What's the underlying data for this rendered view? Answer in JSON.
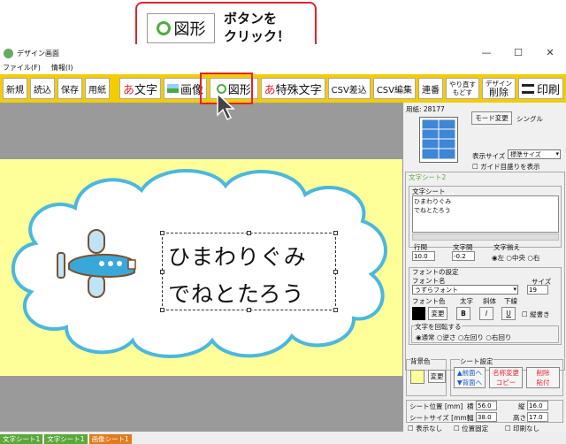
{
  "callout": {
    "button_label": "図形",
    "line1": "ボタンを",
    "line2": "クリック！"
  },
  "window": {
    "title": "デザイン画面",
    "minimize": "—",
    "maximize": "☐",
    "close": "✕"
  },
  "menu": [
    "ファイル(F)",
    "情報(I)"
  ],
  "toolbar": {
    "new": "新規",
    "open": "読込",
    "save": "保存",
    "paper": "用紙",
    "text_icon": "あ",
    "text": "文字",
    "image": "画像",
    "shape": "図形",
    "special_icon": "あ",
    "special": "特殊文字",
    "csv_insert": "CSV差込",
    "csv_edit": "CSV編集",
    "serial": "連番",
    "redo": "やり直す",
    "undo": "もどす",
    "design": "デザイン",
    "delete": "削除",
    "print": "印刷"
  },
  "canvas": {
    "line1": "ひまわりぐみ",
    "line2": "でねとたろう"
  },
  "panel": {
    "paper_label": "用紙: 28177",
    "mode_button": "モード変更",
    "mode_value": "シングル",
    "display_size_label": "表示サイズ",
    "display_size_value": "標準サイズ",
    "guide_label": "ガイド目盛りを表示",
    "sheet_title": "文字シート2",
    "text_sheet_label": "文字シート",
    "text_line1": "ひまわりぐみ",
    "text_line2": "でねとたろう",
    "line_gap_label": "行間",
    "line_gap_value": "10.0",
    "char_gap_label": "文字間",
    "char_gap_value": "-0.2",
    "align_label": "文字揃え",
    "align_left": "左",
    "align_center": "中央",
    "align_right": "右",
    "font_settings_label": "フォントの設定",
    "font_name_label": "フォント名",
    "font_name_value": "うずらフォント",
    "size_label": "サイズ",
    "size_value": "19",
    "font_color_label": "フォント色",
    "bold_label": "太字",
    "italic_label": "斜体",
    "underline_label": "下線",
    "change_button": "変更",
    "bold_btn": "B",
    "italic_btn": "I",
    "underline_btn": "U",
    "vertical_label": "縦書き",
    "rotate_label": "文字を回転する",
    "rotate_normal": "通常",
    "rotate_reverse": "逆さ",
    "rotate_left": "左回り",
    "rotate_right": "右回り",
    "bg_color_label": "背景色",
    "bg_change_button": "変更",
    "sheet_settings_label": "シート設定",
    "front_button": "▲前面へ",
    "back_button": "▼背面へ",
    "rename_button": "名称変更",
    "copy_button": "コピー",
    "delete_button": "削除",
    "paste_button": "貼付",
    "pos_label": "シート位置 [mm]",
    "w_label": "横",
    "w_value": "56.0",
    "h_label": "縦",
    "h_value": "16.0",
    "size_mm_label": "シートサイズ [mm]",
    "width_label": "幅",
    "width_value": "38.0",
    "height_label": "高さ",
    "height_value": "17.0",
    "hide_label": "表示なし",
    "lock_label": "位置固定",
    "noprint_label": "印刷なし"
  },
  "status_tabs": [
    {
      "label": "文字シート1",
      "color": "#5aa83a"
    },
    {
      "label": "文字シート1",
      "color": "#5aa83a"
    },
    {
      "label": "画像シート1",
      "color": "#e07c1c"
    }
  ]
}
